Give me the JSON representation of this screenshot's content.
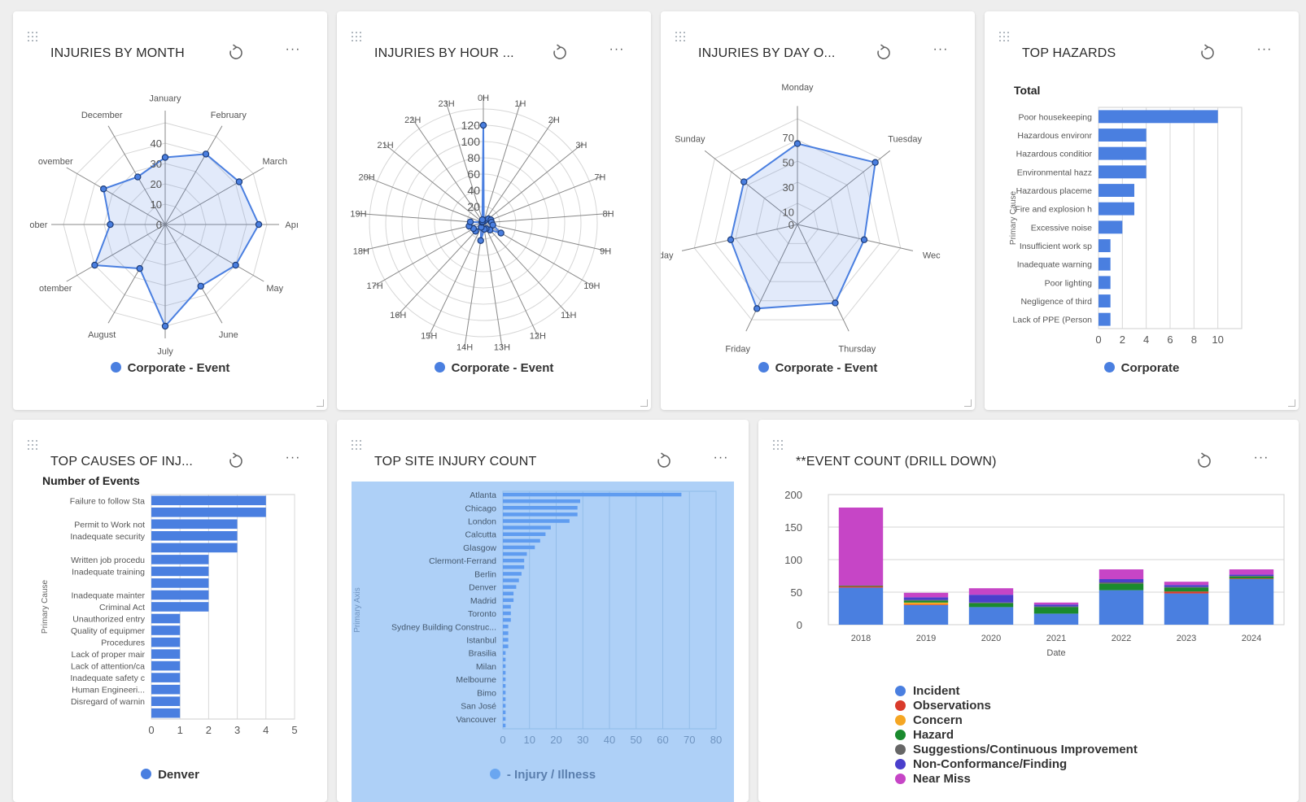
{
  "colors": {
    "accent": "#4a7fe0",
    "bar": "#4a7fe0",
    "page_bg": "#eeeeee",
    "site_panel_bg": "#aed0f7"
  },
  "cards": {
    "injuries_by_month": {
      "title": "INJURIES BY MONTH",
      "legend": "Corporate - Event"
    },
    "injuries_by_hour": {
      "title": "INJURIES BY HOUR ...",
      "legend": "Corporate - Event"
    },
    "injuries_by_day": {
      "title": "INJURIES BY DAY O...",
      "legend": "Corporate - Event"
    },
    "top_hazards": {
      "title": "TOP HAZARDS",
      "legend": "Corporate"
    },
    "top_causes": {
      "title": "TOP CAUSES OF INJ...",
      "legend": "Denver"
    },
    "top_site": {
      "title": "TOP SITE INJURY COUNT",
      "legend": "- Injury / Illness"
    },
    "event_count": {
      "title": "**EVENT COUNT (DRILL DOWN)"
    }
  },
  "icons": {
    "drag": "drag-handle-icon",
    "refresh": "refresh-icon",
    "more": "more-options-icon"
  },
  "more_glyph": "···",
  "chart_data": [
    {
      "id": "month",
      "type": "radar",
      "series_name": "Corporate - Event",
      "categories": [
        "January",
        "February",
        "March",
        "April",
        "May",
        "June",
        "July",
        "August",
        "September",
        "October",
        "November",
        "December"
      ],
      "display_labels": [
        "January",
        "February",
        "March",
        "Apı",
        "May",
        "June",
        "July",
        "August",
        "otember",
        "ober",
        "ovember",
        "December"
      ],
      "values": [
        33,
        40,
        42,
        46,
        40,
        35,
        50,
        25,
        40,
        27,
        35,
        27
      ],
      "ticks": [
        0,
        10,
        20,
        30,
        40
      ],
      "rmax": 50
    },
    {
      "id": "hour",
      "type": "radar",
      "series_name": "Corporate - Event",
      "categories": [
        "0H",
        "1H",
        "2H",
        "3H",
        "7H",
        "8H",
        "9H",
        "10H",
        "11H",
        "12H",
        "13H",
        "14H",
        "15H",
        "16H",
        "17H",
        "18H",
        "19H",
        "20H",
        "21H",
        "22H",
        "23H"
      ],
      "values": [
        120,
        2,
        4,
        8,
        10,
        10,
        12,
        25,
        12,
        8,
        8,
        22,
        6,
        14,
        14,
        18,
        16,
        2,
        2,
        2,
        4
      ],
      "ticks": [
        20,
        40,
        60,
        80,
        100,
        120
      ],
      "rmax": 140
    },
    {
      "id": "day",
      "type": "radar",
      "series_name": "Corporate - Event",
      "categories": [
        "Monday",
        "Tuesday",
        "Wednesday",
        "Thursday",
        "Friday",
        "Saturday",
        "Sunday"
      ],
      "display_labels": [
        "Monday",
        "Tuesday",
        "Wec",
        "Thursday",
        "Friday",
        "ırday",
        "Sunday"
      ],
      "values": [
        65,
        80,
        55,
        70,
        75,
        55,
        55
      ],
      "ticks": [
        0,
        10,
        30,
        50,
        70
      ],
      "rmax": 85
    },
    {
      "id": "hazards",
      "type": "bar",
      "orientation": "horizontal",
      "title": "Total",
      "ylabel": "Primary Cause",
      "series_name": "Corporate",
      "categories": [
        "Poor housekeeping",
        "Hazardous environr",
        "Hazardous conditior",
        "Environmental hazz",
        "Hazardous placeme",
        "Fire and explosion h",
        "Excessive noise",
        "Insufficient work sp",
        "Inadequate warning",
        "Poor lighting",
        "Negligence of third",
        "Lack of PPE (Person"
      ],
      "values": [
        10,
        4,
        4,
        4,
        3,
        3,
        2,
        1,
        1,
        1,
        1,
        1
      ],
      "xticks": [
        0,
        2,
        4,
        6,
        8,
        10
      ],
      "xlim": [
        0,
        12
      ]
    },
    {
      "id": "causes",
      "type": "bar",
      "orientation": "horizontal",
      "title": "Number of Events",
      "ylabel": "Primary Cause",
      "series_name": "Denver",
      "categories": [
        "Failure to follow Sta",
        "Failure to follow Sta",
        "Permit to Work not",
        "Inadequate security",
        "Inadequate security",
        "Written job procedu",
        "Inadequate training",
        "Inadequate training",
        "Inadequate mainter",
        "Criminal Act",
        "Unauthorized entry",
        "Quality of equipmer",
        "Procedures",
        "Lack of proper mair",
        "Lack of attention/ca",
        "Inadequate safety c",
        "Human Engineeri...",
        "Disregard of warnin",
        "Disregard of warnin"
      ],
      "labels_shown": [
        "Failure to follow Sta",
        "",
        "Permit to Work not",
        "Inadequate security",
        "",
        "Written job procedu",
        "Inadequate training",
        "",
        "Inadequate mainter",
        "Criminal Act",
        "Unauthorized entry",
        "Quality of equipmer",
        "Procedures",
        "Lack of proper mair",
        "Lack of attention/ca",
        "Inadequate safety c",
        "Human Engineeri...",
        "Disregard of warnin",
        ""
      ],
      "values": [
        4,
        4,
        3,
        3,
        3,
        2,
        2,
        2,
        2,
        2,
        1,
        1,
        1,
        1,
        1,
        1,
        1,
        1,
        1
      ],
      "xticks": [
        0,
        1,
        2,
        3,
        4,
        5
      ],
      "xlim": [
        0,
        5
      ]
    },
    {
      "id": "sites",
      "type": "bar",
      "orientation": "horizontal",
      "ylabel": "Primary Axis",
      "series_name": "- Injury / Illness",
      "categories": [
        "Atlanta",
        "",
        "Chicago",
        "",
        "London",
        "",
        "Calcutta",
        "",
        "Glasgow",
        "",
        "Clermont-Ferrand",
        "",
        "Berlin",
        "",
        "Denver",
        "",
        "Madrid",
        "",
        "Toronto",
        "",
        "Sydney Building Construc...",
        "",
        "Istanbul",
        "",
        "Brasilia",
        "",
        "Milan",
        "",
        "Melbourne",
        "",
        "Bimo",
        "",
        "San José",
        "",
        "Vancouver",
        ""
      ],
      "values": [
        67,
        29,
        28,
        28,
        25,
        18,
        16,
        14,
        12,
        9,
        8,
        8,
        7,
        6,
        5,
        4,
        4,
        3,
        3,
        3,
        2,
        2,
        2,
        2,
        1,
        1,
        1,
        1,
        1,
        1,
        1,
        1,
        1,
        1,
        1,
        1
      ],
      "xticks": [
        0,
        10,
        20,
        30,
        40,
        50,
        60,
        70,
        80
      ],
      "xlim": [
        0,
        80
      ]
    },
    {
      "id": "events",
      "type": "bar",
      "stacked": true,
      "xlabel": "Date",
      "ylim": [
        0,
        200
      ],
      "yticks": [
        0,
        50,
        100,
        150,
        200
      ],
      "categories": [
        "2018",
        "2019",
        "2020",
        "2021",
        "2022",
        "2023",
        "2024"
      ],
      "series": [
        {
          "name": "Incident",
          "color": "#4a7fe0",
          "values": [
            57,
            30,
            27,
            17,
            53,
            48,
            70
          ]
        },
        {
          "name": "Observations",
          "color": "#d93b2b",
          "values": [
            2,
            1,
            0,
            0,
            0,
            3,
            1
          ]
        },
        {
          "name": "Concern",
          "color": "#f5a623",
          "values": [
            0,
            3,
            0,
            0,
            0,
            0,
            0
          ]
        },
        {
          "name": "Hazard",
          "color": "#1a8a2e",
          "values": [
            1,
            3,
            6,
            10,
            10,
            6,
            3
          ]
        },
        {
          "name": "Suggestions/Continuous Improvement",
          "color": "#666666",
          "values": [
            0,
            1,
            1,
            1,
            2,
            1,
            1
          ]
        },
        {
          "name": "Non-Conformance/Finding",
          "color": "#4a3fcc",
          "values": [
            0,
            4,
            12,
            3,
            5,
            3,
            2
          ]
        },
        {
          "name": "Near Miss",
          "color": "#c645c6",
          "values": [
            120,
            7,
            10,
            3,
            15,
            5,
            8
          ]
        }
      ]
    }
  ]
}
